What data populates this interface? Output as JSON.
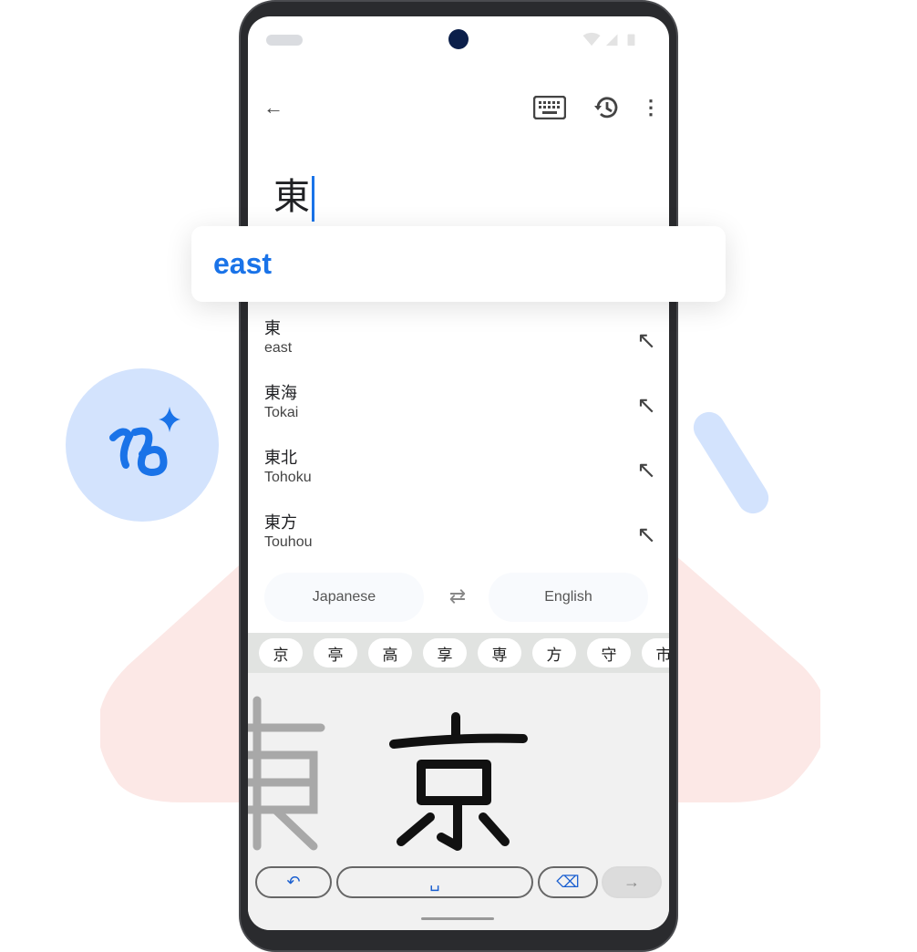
{
  "colors": {
    "accent": "#1a73e8",
    "blob_pink": "#fce8e6",
    "blob_blue": "#d3e3fd"
  },
  "header": {
    "back_icon": "arrow-left",
    "keyboard_icon": "keyboard",
    "history_icon": "history",
    "more_icon": "more-vert"
  },
  "query": {
    "text": "東"
  },
  "top_suggestion": {
    "text": "east"
  },
  "suggestions": [
    {
      "kanji": "東",
      "reading": "east"
    },
    {
      "kanji": "東海",
      "reading": "Tokai"
    },
    {
      "kanji": "東北",
      "reading": "Tohoku"
    },
    {
      "kanji": "東方",
      "reading": "Touhou"
    }
  ],
  "languages": {
    "source": "Japanese",
    "target": "English",
    "swap_icon": "swap-horiz"
  },
  "candidates": [
    "京",
    "亭",
    "高",
    "享",
    "専",
    "方",
    "守",
    "市"
  ],
  "handwriting": {
    "previous": "東",
    "current": "京"
  },
  "keys": {
    "undo_icon": "undo",
    "space_icon": "space-bar",
    "backspace_icon": "backspace",
    "enter_icon": "arrow-right"
  }
}
